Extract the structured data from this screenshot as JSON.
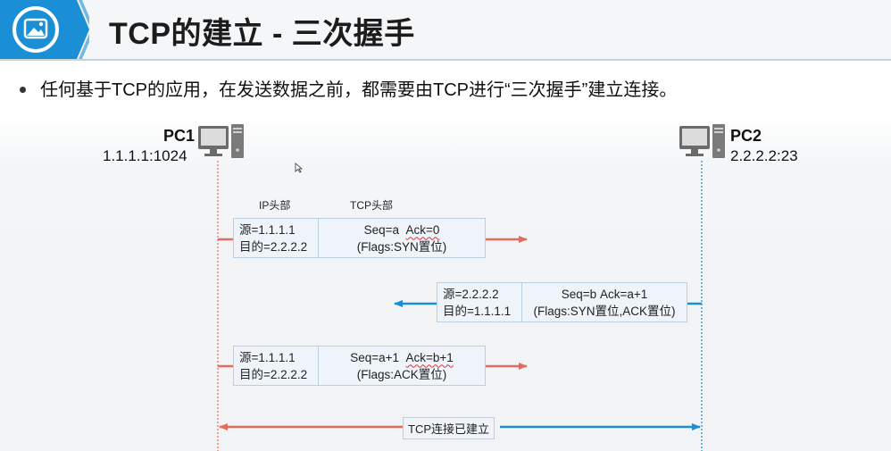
{
  "header": {
    "title": "TCP的建立 - 三次握手",
    "logo_icon": "image-icon"
  },
  "bullet": {
    "text": "任何基于TCP的应用，在发送数据之前，都需要由TCP进行“三次握手”建立连接。"
  },
  "pc1": {
    "name": "PC1",
    "address": "1.1.1.1:1024",
    "icon": "computer-icon"
  },
  "pc2": {
    "name": "PC2",
    "address": "2.2.2.2:23",
    "icon": "computer-icon"
  },
  "columns": {
    "ip_header": "IP头部",
    "tcp_header": "TCP头部"
  },
  "packets": [
    {
      "ip_src": "源=1.1.1.1",
      "ip_dst": "目的=2.2.2.2",
      "tcp_line1_a": "Seq=a",
      "tcp_line1_b": "Ack=0",
      "tcp_line2": "(Flags:SYN置位)"
    },
    {
      "ip_src": "源=2.2.2.2",
      "ip_dst": "目的=1.1.1.1",
      "tcp_line1_a": "Seq=b",
      "tcp_line1_b": "Ack=a+1",
      "tcp_line2": "(Flags:SYN置位,ACK置位)"
    },
    {
      "ip_src": "源=1.1.1.1",
      "ip_dst": "目的=2.2.2.2",
      "tcp_line1_a": "Seq=a+1",
      "tcp_line1_b": "Ack=b+1",
      "tcp_line2": "(Flags:ACK置位)"
    }
  ],
  "established": {
    "label": "TCP连接已建立"
  },
  "colors": {
    "pc1_side": "#e66b5b",
    "pc2_side": "#1a8fd6",
    "packet_fill": "#eef4fa",
    "packet_border": "#b9cfe0"
  }
}
